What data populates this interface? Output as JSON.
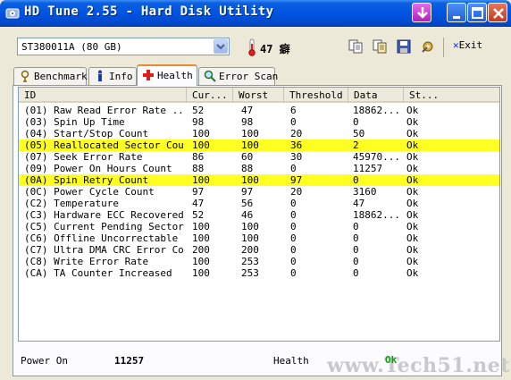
{
  "window": {
    "title": "HD Tune 2.55 - Hard Disk Utility"
  },
  "toolbar": {
    "drive": "ST380011A (80 GB)",
    "temperature": "47 癖",
    "exit_label": "Exit",
    "icons": [
      "copy-icon",
      "copy-all-icon",
      "save-icon",
      "options-icon"
    ]
  },
  "tabs": [
    {
      "label": "Benchmark",
      "icon": "benchmark-icon",
      "active": false
    },
    {
      "label": "Info",
      "icon": "info-icon",
      "active": false
    },
    {
      "label": "Health",
      "icon": "health-icon",
      "active": true
    },
    {
      "label": "Error Scan",
      "icon": "error-scan-icon",
      "active": false
    }
  ],
  "table": {
    "columns": [
      "ID",
      "Cur...",
      "Worst",
      "Threshold",
      "Data",
      "St..."
    ],
    "rows": [
      {
        "id": "(01) Raw Read Error Rate  ...",
        "cur": "52",
        "worst": "47",
        "threshold": "6",
        "data": "18862...",
        "status": "Ok",
        "highlight": false
      },
      {
        "id": "(03) Spin Up Time",
        "cur": "98",
        "worst": "98",
        "threshold": "0",
        "data": "0",
        "status": "Ok",
        "highlight": false
      },
      {
        "id": "(04) Start/Stop Count",
        "cur": "100",
        "worst": "100",
        "threshold": "20",
        "data": "50",
        "status": "Ok",
        "highlight": false
      },
      {
        "id": "(05) Reallocated Sector Cou...",
        "cur": "100",
        "worst": "100",
        "threshold": "36",
        "data": "2",
        "status": "Ok",
        "highlight": true
      },
      {
        "id": "(07) Seek Error Rate",
        "cur": "86",
        "worst": "60",
        "threshold": "30",
        "data": "45970...",
        "status": "Ok",
        "highlight": false
      },
      {
        "id": "(09) Power On Hours Count",
        "cur": "88",
        "worst": "88",
        "threshold": "0",
        "data": "11257",
        "status": "Ok",
        "highlight": false
      },
      {
        "id": "(0A) Spin Retry Count",
        "cur": "100",
        "worst": "100",
        "threshold": "97",
        "data": "0",
        "status": "Ok",
        "highlight": true
      },
      {
        "id": "(0C) Power Cycle Count",
        "cur": "97",
        "worst": "97",
        "threshold": "20",
        "data": "3160",
        "status": "Ok",
        "highlight": false
      },
      {
        "id": "(C2) Temperature",
        "cur": "47",
        "worst": "56",
        "threshold": "0",
        "data": "47",
        "status": "Ok",
        "highlight": false
      },
      {
        "id": "(C3) Hardware ECC Recovered...",
        "cur": "52",
        "worst": "46",
        "threshold": "0",
        "data": "18862...",
        "status": "Ok",
        "highlight": false
      },
      {
        "id": "(C5) Current Pending Sector...",
        "cur": "100",
        "worst": "100",
        "threshold": "0",
        "data": "0",
        "status": "Ok",
        "highlight": false
      },
      {
        "id": "(C6) Offline Uncorrectable",
        "cur": "100",
        "worst": "100",
        "threshold": "0",
        "data": "0",
        "status": "Ok",
        "highlight": false
      },
      {
        "id": "(C7) Ultra DMA CRC Error Co...",
        "cur": "200",
        "worst": "200",
        "threshold": "0",
        "data": "0",
        "status": "Ok",
        "highlight": false
      },
      {
        "id": "(C8) Write Error Rate",
        "cur": "100",
        "worst": "253",
        "threshold": "0",
        "data": "0",
        "status": "Ok",
        "highlight": false
      },
      {
        "id": "(CA) TA Counter Increased",
        "cur": "100",
        "worst": "253",
        "threshold": "0",
        "data": "0",
        "status": "Ok",
        "highlight": false
      }
    ]
  },
  "status": {
    "power_on_label": "Power On",
    "power_on_value": "11257",
    "health_label": "Health",
    "health_value": "Ok"
  },
  "watermark": "www.Tech51.net",
  "colors": {
    "title_bar": "#0054e3",
    "highlight_row": "#ffff22",
    "active_tab_accent": "#e68b2c",
    "health_ok": "#10a010"
  }
}
